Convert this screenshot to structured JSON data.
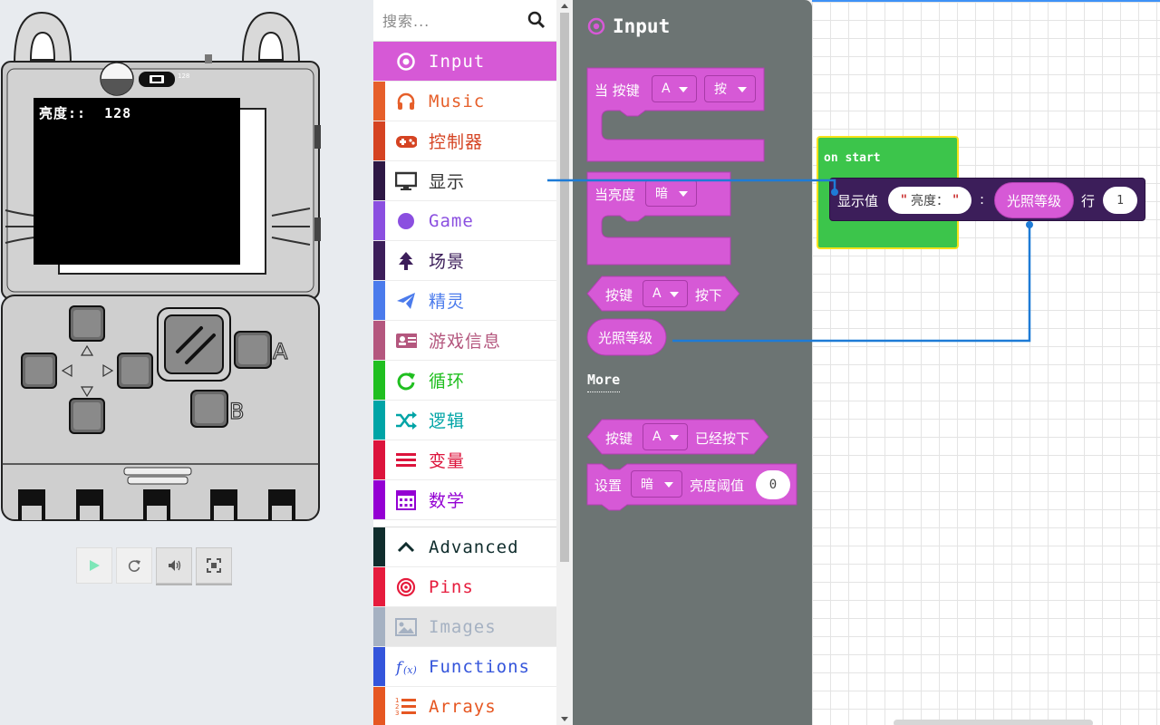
{
  "simulator": {
    "screen_text": "亮度::  128",
    "light_level": "128",
    "buttons": {
      "a": "A",
      "b": "B"
    }
  },
  "toolbox": {
    "search": {
      "placeholder": "搜索..."
    },
    "categories": [
      {
        "label": "Input",
        "color": "#d659d6",
        "icon": "target-icon",
        "selected": true
      },
      {
        "label": "Music",
        "color": "#e65f2a",
        "icon": "headphones-icon"
      },
      {
        "label": "控制器",
        "color": "#d54322",
        "icon": "gamepad-icon"
      },
      {
        "label": "显示",
        "color": "#333333",
        "icon": "monitor-icon"
      },
      {
        "label": "Game",
        "color": "#8b4fe0",
        "icon": "circle-icon"
      },
      {
        "label": "场景",
        "color": "#3c1e5a",
        "icon": "tree-icon"
      },
      {
        "label": "精灵",
        "color": "#4b7bec",
        "icon": "paper-plane-icon"
      },
      {
        "label": "游戏信息",
        "color": "#b4577e",
        "icon": "id-card-icon"
      },
      {
        "label": "循环",
        "color": "#20bf20",
        "icon": "refresh-icon"
      },
      {
        "label": "逻辑",
        "color": "#00a4a6",
        "icon": "shuffle-icon"
      },
      {
        "label": "变量",
        "color": "#dc143c",
        "icon": "list-icon"
      },
      {
        "label": "数学",
        "color": "#9400d3",
        "icon": "calculator-icon"
      }
    ],
    "advanced": [
      {
        "label": "Advanced",
        "color": "#102d2d",
        "icon": "chevron-up-icon"
      },
      {
        "label": "Pins",
        "color": "#e61c3d",
        "icon": "bullseye-icon"
      },
      {
        "label": "Images",
        "color": "#a5b1c2",
        "icon": "image-icon"
      },
      {
        "label": "Functions",
        "color": "#3455db",
        "icon": "function-icon"
      },
      {
        "label": "Arrays",
        "color": "#e65722",
        "icon": "numbered-list-icon"
      }
    ]
  },
  "flyout": {
    "title": "Input",
    "more_label": "More",
    "block_when_button": {
      "prefix": "当 按键",
      "button": "A",
      "event": "按"
    },
    "block_when_light": {
      "prefix": "当亮度",
      "level": "暗"
    },
    "block_button_pressed": {
      "prefix": "按键",
      "button": "A",
      "suffix": "按下"
    },
    "block_light_level": {
      "label": "光照等级"
    },
    "block_was_pressed": {
      "prefix": "按键",
      "button": "A",
      "suffix": "已经按下"
    },
    "block_set_threshold": {
      "prefix": "设置",
      "level": "暗",
      "label": "亮度阈值",
      "value": "0"
    }
  },
  "workspace": {
    "on_start_label": "on start",
    "show_value": {
      "label": "显示值",
      "string": "亮度：",
      "colon": ":",
      "value_block": "光照等级",
      "row_label": "行",
      "row_value": "1"
    }
  },
  "colors": {
    "input": "#d659d6",
    "on_start": "#3cc54b",
    "display": "#3c1e5a",
    "flyout_bg": "#6c7473",
    "connector": "#1e7bd6"
  }
}
